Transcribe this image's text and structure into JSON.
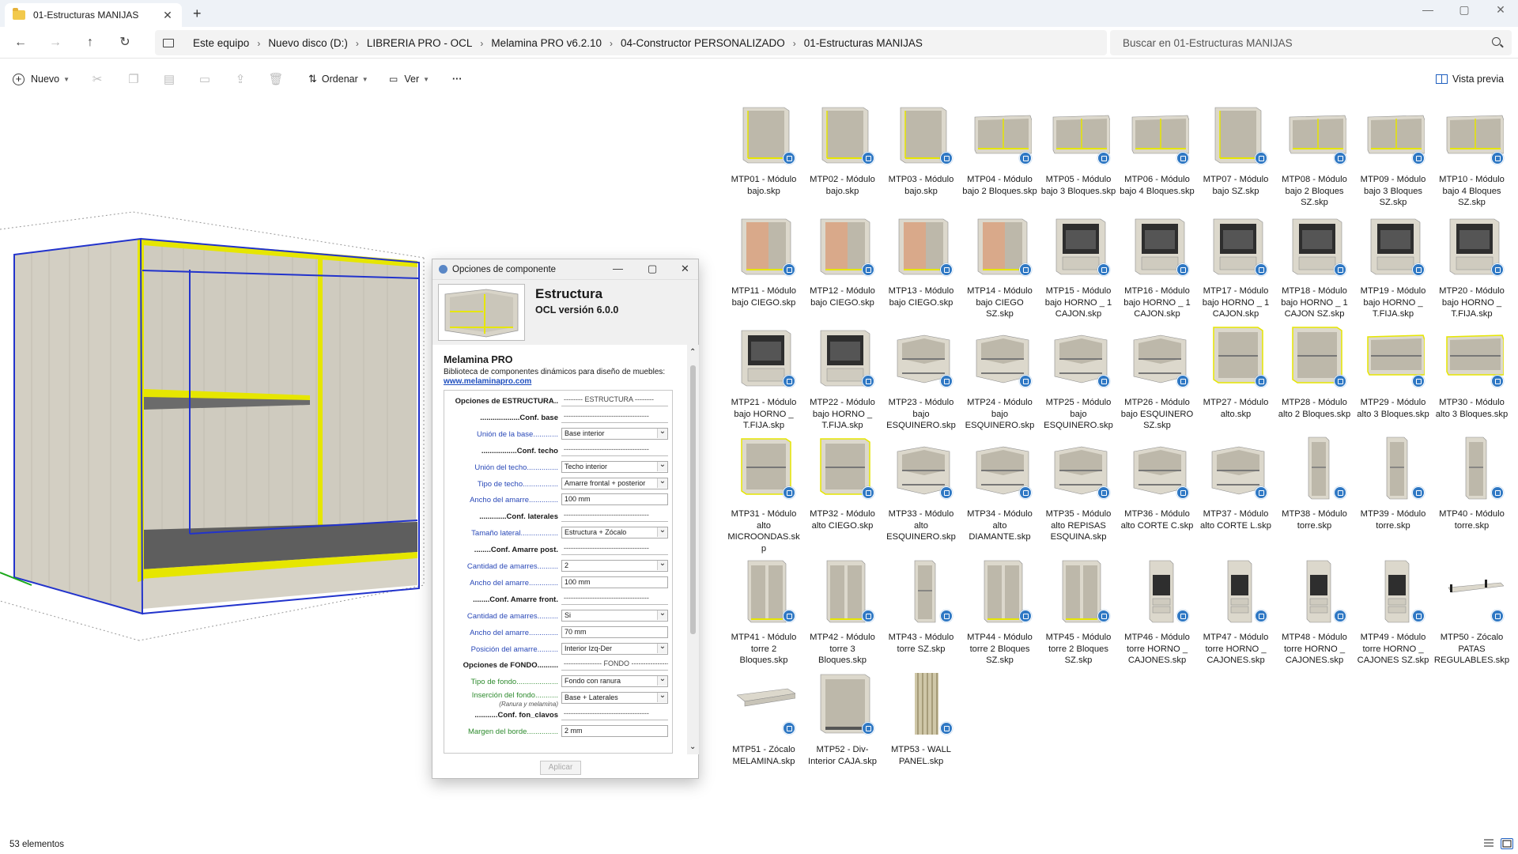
{
  "window": {
    "tab_title": "01-Estructuras MANIJAS",
    "min": "—",
    "max": "▢",
    "close": "✕"
  },
  "nav": {
    "breadcrumb": [
      "Este equipo",
      "Nuevo disco (D:)",
      "LIBRERIA PRO - OCL",
      "Melamina PRO v6.2.10",
      "04-Constructor PERSONALIZADO",
      "01-Estructuras MANIJAS"
    ],
    "search_placeholder": "Buscar en 01-Estructuras MANIJAS"
  },
  "toolbar": {
    "new_label": "Nuevo",
    "sort_label": "Ordenar",
    "view_label": "Ver",
    "more_label": "···",
    "preview_label": "Vista previa"
  },
  "dialog": {
    "title": "Opciones de componente",
    "component_name": "Estructura",
    "version": "OCL versión 6.0.0",
    "section_title": "Melamina PRO",
    "description": "Biblioteca de componentes dinámicos para diseño de muebles:",
    "link": "www.melaminapro.com",
    "apply_label": "Aplicar",
    "options": [
      {
        "label": "Opciones de ESTRUCTURA..",
        "style": "sec",
        "value": "-------- ESTRUCTURA --------",
        "type": "dash"
      },
      {
        "label": "...................Conf. base",
        "style": "sec",
        "value": "------------------------------------",
        "type": "dash"
      },
      {
        "label": "Unión de la base............",
        "style": "blue",
        "value": "Base interior",
        "type": "sel"
      },
      {
        "label": ".................Conf. techo",
        "style": "sec",
        "value": "------------------------------------",
        "type": "dash"
      },
      {
        "label": "Unión del techo...............",
        "style": "blue",
        "value": "Techo interior",
        "type": "sel"
      },
      {
        "label": "Tipo de techo.................",
        "style": "blue",
        "value": "Amarre frontal + posterior",
        "type": "sel"
      },
      {
        "label": "Ancho del amarre..............",
        "style": "blue",
        "value": "100 mm",
        "type": "txt"
      },
      {
        "label": ".............Conf. laterales",
        "style": "sec",
        "value": "------------------------------------",
        "type": "dash"
      },
      {
        "label": "Tamaño lateral..................",
        "style": "blue",
        "value": "Estructura + Zócalo",
        "type": "sel"
      },
      {
        "label": "........Conf. Amarre post.",
        "style": "sec",
        "value": "------------------------------------",
        "type": "dash"
      },
      {
        "label": "Cantidad de amarres..........",
        "style": "blue",
        "value": "2",
        "type": "sel"
      },
      {
        "label": "Ancho del amarre..............",
        "style": "blue",
        "value": "100 mm",
        "type": "txt"
      },
      {
        "label": "........Conf. Amarre front.",
        "style": "sec",
        "value": "------------------------------------",
        "type": "dash"
      },
      {
        "label": "Cantidad de amarres..........",
        "style": "blue",
        "value": "Si",
        "type": "sel"
      },
      {
        "label": "Ancho del amarre..............",
        "style": "blue",
        "value": "70 mm",
        "type": "txt"
      },
      {
        "label": "Posición del amarre..........",
        "style": "blue",
        "value": "Interior Izq-Der",
        "type": "sel"
      },
      {
        "label": "Opciones de FONDO..........",
        "style": "sec",
        "value": "---------------- FONDO ----------------",
        "type": "dash"
      },
      {
        "label": "Tipo de fondo....................",
        "style": "green",
        "value": "Fondo con ranura",
        "type": "sel"
      },
      {
        "label": "Inserción del fondo...........",
        "style": "green",
        "value": "Base + Laterales",
        "type": "sel",
        "sub": "(Ranura y melamina)"
      },
      {
        "label": "...........Conf. fon_clavos",
        "style": "sec",
        "value": "------------------------------------",
        "type": "dash"
      },
      {
        "label": "Margen del borde...............",
        "style": "green",
        "value": "2 mm",
        "type": "txt"
      }
    ]
  },
  "files": [
    {
      "name": "MTP01 - Módulo bajo.skp",
      "kind": "base"
    },
    {
      "name": "MTP02 - Módulo bajo.skp",
      "kind": "base"
    },
    {
      "name": "MTP03 - Módulo bajo.skp",
      "kind": "base"
    },
    {
      "name": "MTP04 - Módulo bajo 2 Bloques.skp",
      "kind": "wide"
    },
    {
      "name": "MTP05 - Módulo bajo 3 Bloques.skp",
      "kind": "wide"
    },
    {
      "name": "MTP06 - Módulo bajo 4 Bloques.skp",
      "kind": "wide"
    },
    {
      "name": "MTP07 - Módulo bajo SZ.skp",
      "kind": "base"
    },
    {
      "name": "MTP08 - Módulo bajo 2 Bloques SZ.skp",
      "kind": "wide"
    },
    {
      "name": "MTP09 - Módulo bajo 3 Bloques SZ.skp",
      "kind": "wide"
    },
    {
      "name": "MTP10 - Módulo bajo 4 Bloques SZ.skp",
      "kind": "wide"
    },
    {
      "name": "MTP11 - Módulo bajo CIEGO.skp",
      "kind": "blind"
    },
    {
      "name": "MTP12 - Módulo bajo CIEGO.skp",
      "kind": "blind"
    },
    {
      "name": "MTP13 - Módulo bajo CIEGO.skp",
      "kind": "blind"
    },
    {
      "name": "MTP14 - Módulo bajo CIEGO SZ.skp",
      "kind": "blind"
    },
    {
      "name": "MTP15 - Módulo bajo HORNO _ 1 CAJON.skp",
      "kind": "oven"
    },
    {
      "name": "MTP16 - Módulo bajo HORNO _ 1 CAJON.skp",
      "kind": "oven"
    },
    {
      "name": "MTP17 - Módulo bajo HORNO _ 1 CAJON.skp",
      "kind": "oven"
    },
    {
      "name": "MTP18 - Módulo bajo HORNO _ 1 CAJON SZ.skp",
      "kind": "oven"
    },
    {
      "name": "MTP19 - Módulo bajo HORNO _ T.FIJA.skp",
      "kind": "oven"
    },
    {
      "name": "MTP20 - Módulo bajo HORNO _ T.FIJA.skp",
      "kind": "oven"
    },
    {
      "name": "MTP21 - Módulo bajo HORNO _ T.FIJA.skp",
      "kind": "oven"
    },
    {
      "name": "MTP22 - Módulo bajo HORNO _ T.FIJA.skp",
      "kind": "oven"
    },
    {
      "name": "MTP23 - Módulo bajo ESQUINERO.skp",
      "kind": "corner"
    },
    {
      "name": "MTP24 - Módulo bajo ESQUINERO.skp",
      "kind": "corner"
    },
    {
      "name": "MTP25 - Módulo bajo ESQUINERO.skp",
      "kind": "corner"
    },
    {
      "name": "MTP26 - Módulo bajo ESQUINERO SZ.skp",
      "kind": "corner"
    },
    {
      "name": "MTP27 - Módulo alto.skp",
      "kind": "upper"
    },
    {
      "name": "MTP28 - Módulo alto 2 Bloques.skp",
      "kind": "upper"
    },
    {
      "name": "MTP29 - Módulo alto 3 Bloques.skp",
      "kind": "upperwide"
    },
    {
      "name": "MTP30 - Módulo alto 3 Bloques.skp",
      "kind": "upperwide"
    },
    {
      "name": "MTP31 - Módulo alto MICROONDAS.skp",
      "kind": "upper"
    },
    {
      "name": "MTP32 - Módulo alto CIEGO.skp",
      "kind": "upper"
    },
    {
      "name": "MTP33 - Módulo alto ESQUINERO.skp",
      "kind": "corner"
    },
    {
      "name": "MTP34 - Módulo alto DIAMANTE.skp",
      "kind": "corner"
    },
    {
      "name": "MTP35 - Módulo alto REPISAS ESQUINA.skp",
      "kind": "corner"
    },
    {
      "name": "MTP36 - Módulo alto CORTE C.skp",
      "kind": "corner"
    },
    {
      "name": "MTP37 - Módulo alto CORTE L.skp",
      "kind": "corner"
    },
    {
      "name": "MTP38 - Módulo torre.skp",
      "kind": "tower"
    },
    {
      "name": "MTP39 - Módulo torre.skp",
      "kind": "tower"
    },
    {
      "name": "MTP40 - Módulo torre.skp",
      "kind": "tower"
    },
    {
      "name": "MTP41 - Módulo torre 2 Bloques.skp",
      "kind": "tower2"
    },
    {
      "name": "MTP42 - Módulo torre 3 Bloques.skp",
      "kind": "tower2"
    },
    {
      "name": "MTP43 - Módulo torre SZ.skp",
      "kind": "tower"
    },
    {
      "name": "MTP44 - Módulo torre 2 Bloques SZ.skp",
      "kind": "tower2"
    },
    {
      "name": "MTP45 - Módulo torre 2 Bloques SZ.skp",
      "kind": "tower2"
    },
    {
      "name": "MTP46 - Módulo torre HORNO _ CAJONES.skp",
      "kind": "toweroven"
    },
    {
      "name": "MTP47 - Módulo torre HORNO _ CAJONES.skp",
      "kind": "toweroven"
    },
    {
      "name": "MTP48 - Módulo torre HORNO _ CAJONES.skp",
      "kind": "toweroven"
    },
    {
      "name": "MTP49 - Módulo torre HORNO _ CAJONES SZ.skp",
      "kind": "toweroven"
    },
    {
      "name": "MTP50 - Zócalo PATAS REGULABLES.skp",
      "kind": "plinth"
    },
    {
      "name": "MTP51 - Zócalo MELAMINA.skp",
      "kind": "plinth2"
    },
    {
      "name": "MTP52 - Div-Interior CAJA.skp",
      "kind": "box"
    },
    {
      "name": "MTP53 - WALL PANEL.skp",
      "kind": "panel"
    }
  ],
  "status": {
    "count": "53 elementos"
  },
  "colors": {
    "wood": "#d8d4c8",
    "yellow_edge": "#e6e600",
    "blue_outline": "#2233cc",
    "blind_wood": "#d9a98a",
    "oven": "#333333",
    "badge": "#2f78c4"
  }
}
